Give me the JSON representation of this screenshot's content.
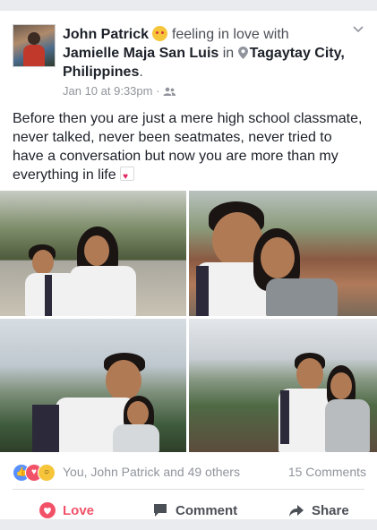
{
  "post": {
    "author": "John Patrick",
    "feeling_text": "feeling in love with",
    "tagged": "Jamielle Maja San Luis",
    "in_text": "in",
    "location": "Tagaytay City, Philippines",
    "period": ".",
    "timestamp": "Jan 10 at 9:33pm",
    "separator": "·",
    "body": "Before then you are just a mere high school classmate, never talked, never been seatmates, never tried to have a conversation but now you are more than my everything in life"
  },
  "reactions": {
    "summary": "You, John Patrick and 49 others",
    "comments": "15 Comments",
    "icons": [
      "like-icon",
      "love-icon",
      "wow-icon"
    ]
  },
  "actions": {
    "love": "Love",
    "comment": "Comment",
    "share": "Share"
  },
  "colors": {
    "love_red": "#f25268",
    "like_blue": "#5890ff",
    "wow_yellow": "#f7c53a",
    "text_dark": "#1d2129",
    "text_gray": "#90949c"
  }
}
